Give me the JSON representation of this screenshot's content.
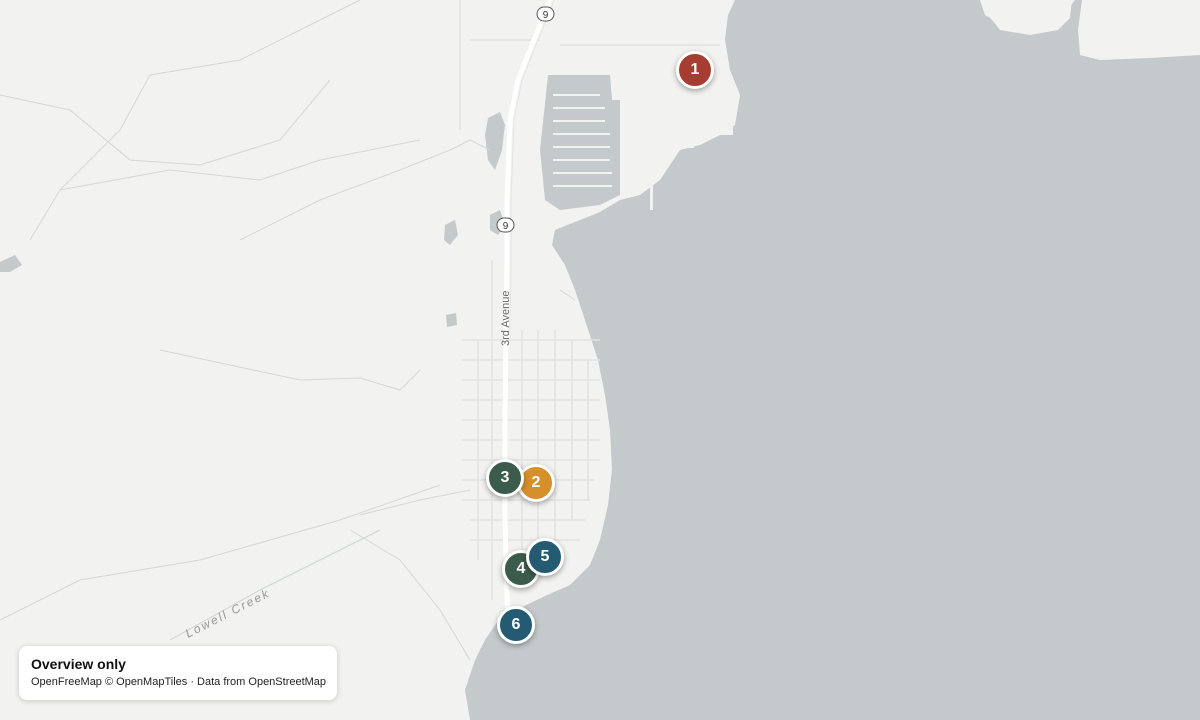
{
  "map": {
    "land_color": "#f2f2f1",
    "water_color": "#c4c9cc",
    "labels": {
      "road": "3rd Avenue",
      "creek": "Lowell Creek",
      "highway_shield": "9"
    }
  },
  "markers": [
    {
      "label": "1",
      "color": "#a63d32"
    },
    {
      "label": "2",
      "color": "#d6902a"
    },
    {
      "label": "3",
      "color": "#3c5c4b"
    },
    {
      "label": "4",
      "color": "#3c5c4b"
    },
    {
      "label": "5",
      "color": "#245b73"
    },
    {
      "label": "6",
      "color": "#245b73"
    }
  ],
  "attribution": {
    "title": "Overview only",
    "credits": "OpenFreeMap © OpenMapTiles · Data from OpenStreetMap"
  }
}
